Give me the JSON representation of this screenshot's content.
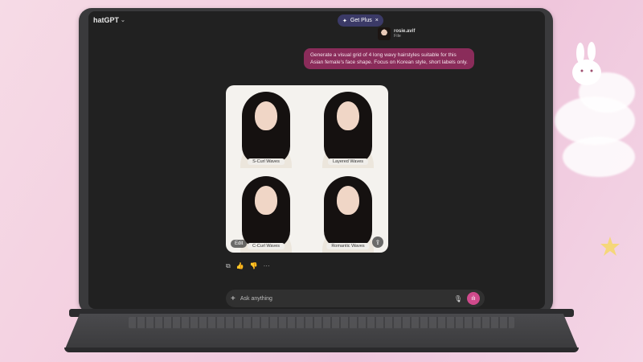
{
  "app": {
    "model_name": "hatGPT"
  },
  "header": {
    "get_plus_label": "Get Plus"
  },
  "attachment": {
    "name": "rosie.avif",
    "type": "File"
  },
  "user_message": "Generate a visual grid of 4 long wavy hairstyles suitable for this Asian female's face shape. Focus on Korean style, short labels only.",
  "image_grid": {
    "labels": [
      "S-Curl Waves",
      "Layered Waves",
      "C-Curl Waves",
      "Romantic Waves"
    ],
    "edit_label": "Edit"
  },
  "composer": {
    "placeholder": "Ask anything"
  },
  "icons": {
    "chevron": "chevron-down-icon",
    "sparkle": "sparkle-icon",
    "close": "close-icon",
    "copy": "copy-icon",
    "thumbs_up": "thumbs-up-icon",
    "thumbs_down": "thumbs-down-icon",
    "more": "more-icon",
    "plus": "plus-icon",
    "mic": "mic-icon",
    "voice": "voice-mode-icon",
    "share": "share-icon"
  },
  "colors": {
    "user_bubble": "#8a2c5a",
    "plus_pill": "#3b3a67",
    "voice_button": "#d04a8c",
    "screen_bg": "#212121"
  }
}
